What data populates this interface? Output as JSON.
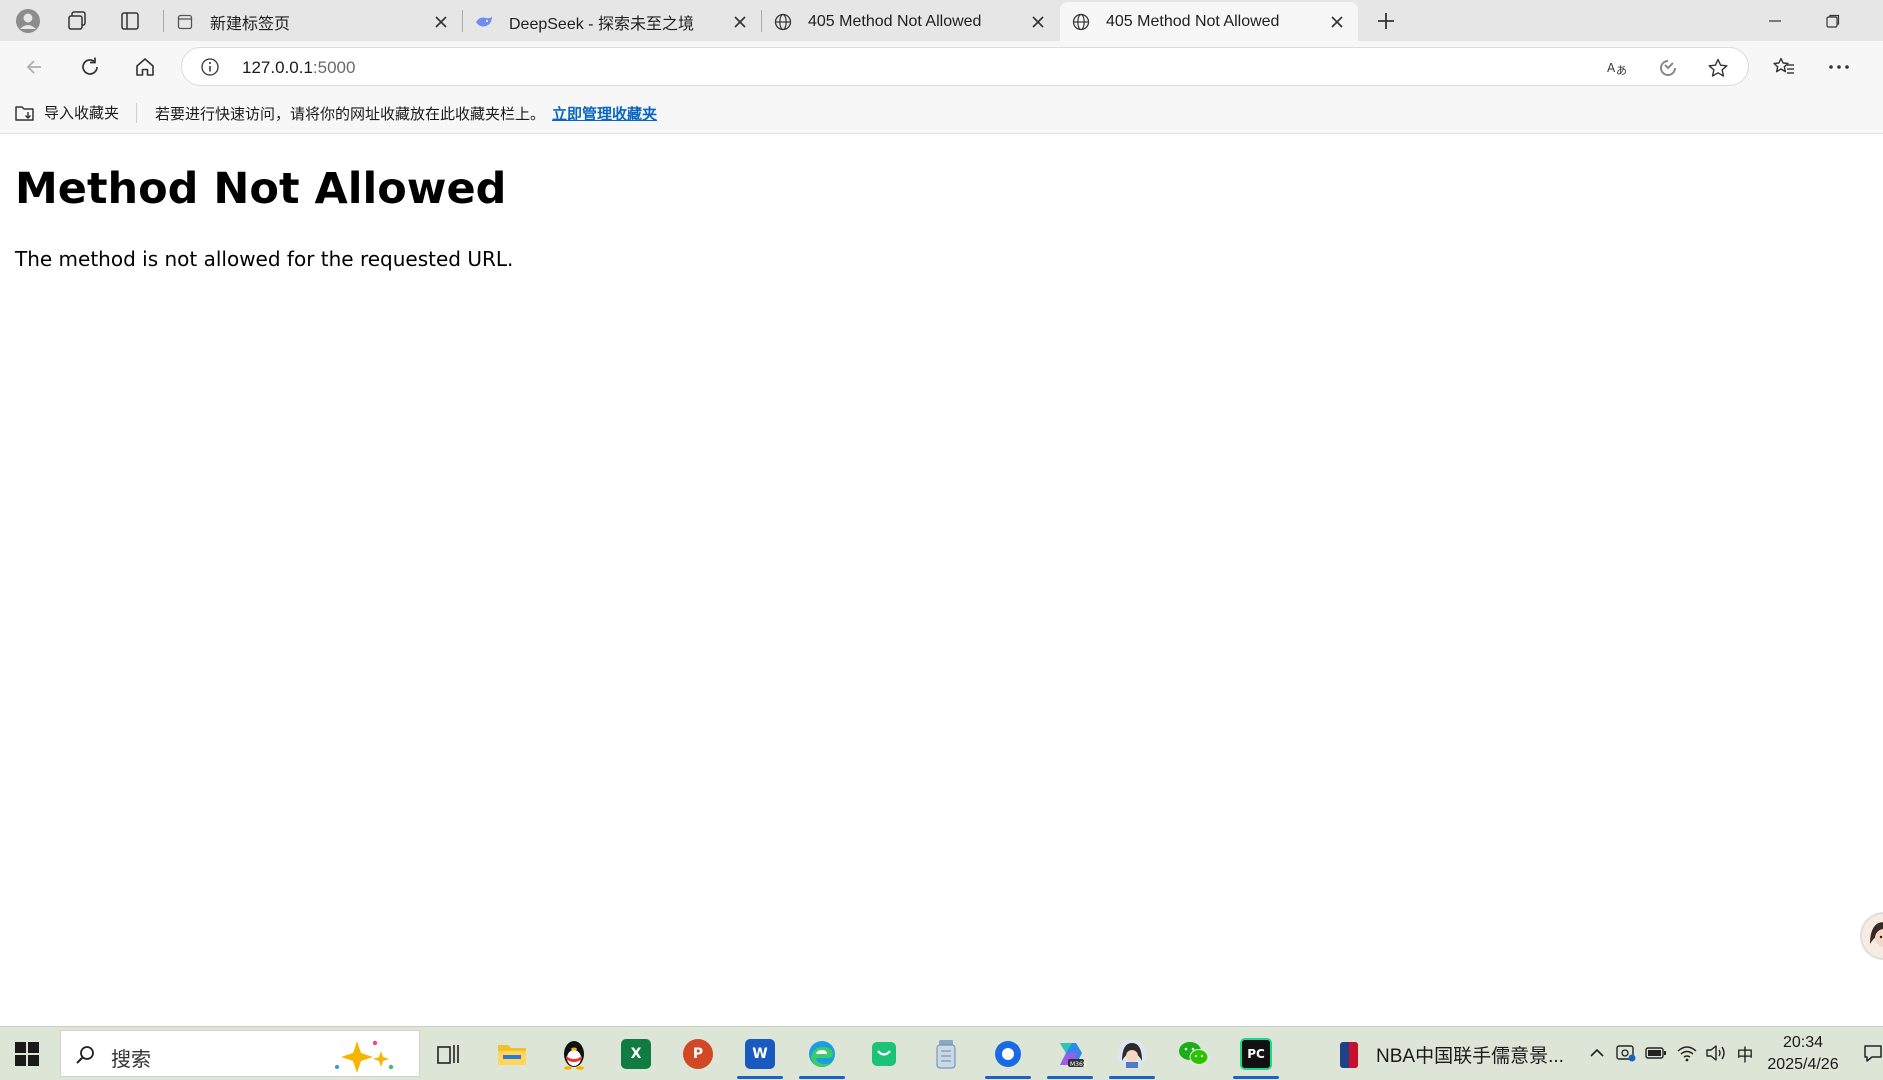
{
  "tabs": [
    {
      "title": "新建标签页",
      "favicon": "blank-page-icon",
      "active": false
    },
    {
      "title": "DeepSeek - 探索未至之境",
      "favicon": "deepseek-whale-icon",
      "active": false
    },
    {
      "title": "405 Method Not Allowed",
      "favicon": "globe-icon",
      "active": false
    },
    {
      "title": "405 Method Not Allowed",
      "favicon": "globe-icon",
      "active": true
    }
  ],
  "address_bar": {
    "host": "127.0.0.1",
    "port": ":5000"
  },
  "favorites_bar": {
    "import_label": "导入收藏夹",
    "hint": "若要进行快速访问，请将你的网址收藏放在此收藏夹栏上。",
    "manage_link": "立即管理收藏夹"
  },
  "page": {
    "heading": "Method Not Allowed",
    "message": "The method is not allowed for the requested URL."
  },
  "taskbar": {
    "search_placeholder": "搜索",
    "news_text": "NBA中国联手儒意景...",
    "ime": "中",
    "time": "20:34",
    "date": "2025/4/26",
    "apps": [
      "task-view",
      "file-explorer",
      "qq",
      "excel",
      "powerpoint",
      "word",
      "edge",
      "app-green",
      "archive",
      "app-blue-circle",
      "m365",
      "avatar-app",
      "wechat",
      "pycharm"
    ],
    "pycharm_label": "PC",
    "excel_label": "X",
    "powerpoint_label": "P",
    "word_label": "W"
  },
  "colors": {
    "link": "#0b66c2",
    "taskbar": "#dde6d6",
    "active_underline": "#1664c9"
  }
}
